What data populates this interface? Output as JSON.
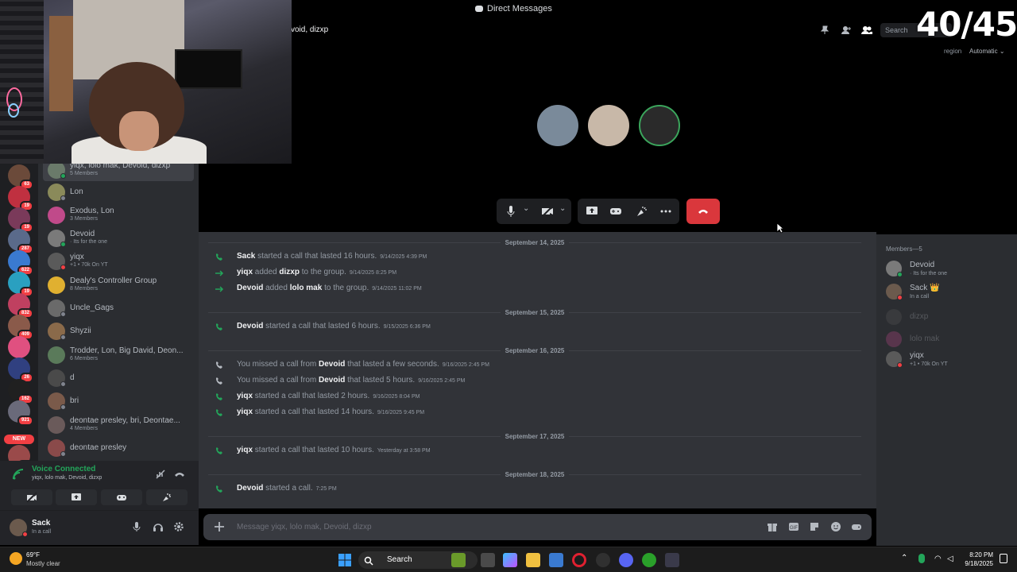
{
  "window": {
    "title": "Direct Messages"
  },
  "stream_overlay": {
    "counter": "40/45"
  },
  "guilds": [
    {
      "badge": "63",
      "color": "#6b4a3a"
    },
    {
      "badge": "19",
      "color": "#c03040"
    },
    {
      "badge": "19",
      "color": "#7a3a5a"
    },
    {
      "badge": "287",
      "color": "#5a6a8a"
    },
    {
      "badge": "622",
      "color": "#3a7ad0"
    },
    {
      "badge": "19",
      "color": "#2aa0c0"
    },
    {
      "badge": "832",
      "color": "#c04060"
    },
    {
      "badge": "409",
      "color": "#8a5a4a"
    },
    {
      "badge": "",
      "color": "#e05080"
    },
    {
      "badge": "26",
      "color": "#304080"
    },
    {
      "badge": "162",
      "color": "#202020"
    },
    {
      "badge": "921",
      "color": "#6a6a7a"
    },
    {
      "badge": "180",
      "color": "#9a4a4a"
    }
  ],
  "guild_new_label": "NEW",
  "dms": [
    {
      "name": "yiqx, lolo mak, Devoid, dizxp",
      "sub": "5 Members",
      "status": "online",
      "color": "#6a7a6a",
      "active": true
    },
    {
      "name": "Lon",
      "sub": "",
      "status": "idle",
      "color": "#8a8a5a"
    },
    {
      "name": "Exodus, Lon",
      "sub": "3 Members",
      "status": "",
      "color": "#c04a8a"
    },
    {
      "name": "Devoid",
      "sub": "· Its for the one",
      "status": "online",
      "color": "#7a7a7a"
    },
    {
      "name": "yiqx",
      "sub": "+1 • 70k On YT",
      "status": "dnd",
      "color": "#5a5a5a"
    },
    {
      "name": "Dealy's Controller Group",
      "sub": "8 Members",
      "status": "",
      "color": "#e0b030"
    },
    {
      "name": "Uncle_Gags",
      "sub": "",
      "status": "idle",
      "color": "#6a6a6a"
    },
    {
      "name": "Shyzii",
      "sub": "",
      "status": "idle",
      "color": "#8a6a4a"
    },
    {
      "name": "Trodder, Lon, Big David, Deon...",
      "sub": "6 Members",
      "status": "",
      "color": "#5a7a5a"
    },
    {
      "name": "d",
      "sub": "",
      "status": "idle",
      "color": "#4a4a4a"
    },
    {
      "name": "bri",
      "sub": "",
      "status": "idle",
      "color": "#7a5a4a"
    },
    {
      "name": "deontae presley, bri, Deontae...",
      "sub": "4 Members",
      "status": "",
      "color": "#6a5a5a"
    },
    {
      "name": "deontae presley",
      "sub": "",
      "status": "idle",
      "color": "#8a4a4a"
    }
  ],
  "voice": {
    "title": "Voice Connected",
    "channel": "yiqx, lolo mak, Devoid, dizxp"
  },
  "user": {
    "name": "Sack",
    "status": "In a call"
  },
  "header": {
    "title": "void, dizxp",
    "search_placeholder": "Search",
    "region_label": "region",
    "region_value": "Automatic"
  },
  "call_participants": [
    {
      "name": "participant-1",
      "color": "#7a8a9a"
    },
    {
      "name": "participant-2",
      "color": "#c8b8a8"
    },
    {
      "name": "participant-3",
      "color": "#2a2a2a"
    }
  ],
  "chat": {
    "dates": [
      "September 14, 2025",
      "September 15, 2025",
      "September 16, 2025",
      "September 17, 2025",
      "September 18, 2025"
    ],
    "messages": [
      {
        "type": "call",
        "pre": "",
        "user": "Sack",
        "mid": " started a call that lasted 16 hours.",
        "user2": "",
        "post": "",
        "ts": "9/14/2025 4:39 PM"
      },
      {
        "type": "add",
        "pre": "",
        "user": "yiqx",
        "mid": " added ",
        "user2": "dizxp",
        "post": " to the group.",
        "ts": "9/14/2025 8:25 PM"
      },
      {
        "type": "add",
        "pre": "",
        "user": "Devoid",
        "mid": " added ",
        "user2": "lolo mak",
        "post": " to the group.",
        "ts": "9/14/2025 11:02 PM"
      },
      {
        "type": "call",
        "pre": "",
        "user": "Devoid",
        "mid": " started a call that lasted 6 hours.",
        "user2": "",
        "post": "",
        "ts": "9/15/2025 6:36 PM"
      },
      {
        "type": "missed",
        "pre": "You missed a call from ",
        "user": "Devoid",
        "mid": " that lasted a few seconds.",
        "user2": "",
        "post": "",
        "ts": "9/16/2025 2:45 PM"
      },
      {
        "type": "missed",
        "pre": "You missed a call from ",
        "user": "Devoid",
        "mid": " that lasted 5 hours.",
        "user2": "",
        "post": "",
        "ts": "9/16/2025 2:45 PM"
      },
      {
        "type": "call",
        "pre": "",
        "user": "yiqx",
        "mid": " started a call that lasted 2 hours.",
        "user2": "",
        "post": "",
        "ts": "9/16/2025 8:04 PM"
      },
      {
        "type": "call",
        "pre": "",
        "user": "yiqx",
        "mid": " started a call that lasted 14 hours.",
        "user2": "",
        "post": "",
        "ts": "9/16/2025 9:45 PM"
      },
      {
        "type": "call",
        "pre": "",
        "user": "yiqx",
        "mid": " started a call that lasted 10 hours.",
        "user2": "",
        "post": "",
        "ts": "Yesterday at 3:58 PM"
      },
      {
        "type": "call",
        "pre": "",
        "user": "Devoid",
        "mid": " started a call.",
        "user2": "",
        "post": "",
        "ts": "7:25 PM"
      }
    ],
    "composer_placeholder": "Message yiqx, lolo mak, Devoid, dizxp"
  },
  "members": {
    "header": "Members—5",
    "list": [
      {
        "name": "Devoid",
        "sub": "· Its for the one",
        "status": "online",
        "offline": false,
        "color": "#7a7a7a"
      },
      {
        "name": "Sack 👑",
        "sub": "In a call",
        "status": "dnd",
        "offline": false,
        "color": "#6b5a4d"
      },
      {
        "name": "dizxp",
        "sub": "",
        "status": "",
        "offline": true,
        "color": "#5a5a5a"
      },
      {
        "name": "lolo mak",
        "sub": "",
        "status": "",
        "offline": true,
        "color": "#c04a8a"
      },
      {
        "name": "yiqx",
        "sub": "+1 • 70k On YT",
        "status": "dnd",
        "offline": false,
        "color": "#5a5a5a"
      }
    ]
  },
  "taskbar": {
    "weather_temp": "69°F",
    "weather_desc": "Mostly clear",
    "search_label": "Search",
    "time": "8:20 PM",
    "date": "9/18/2025"
  },
  "colors": {
    "accent_green": "#23a55a",
    "danger_red": "#da373c",
    "background": "#313338"
  }
}
